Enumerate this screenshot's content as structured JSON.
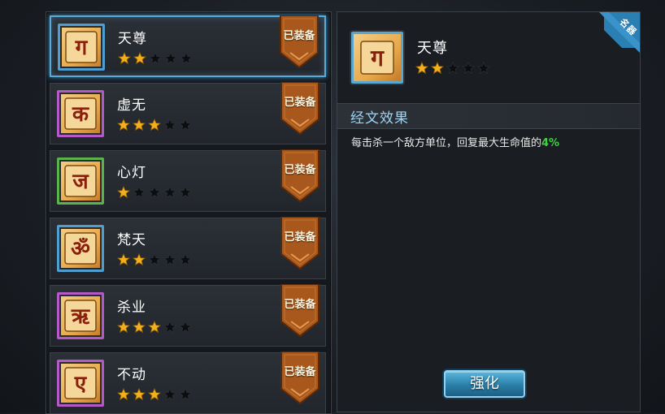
{
  "list": {
    "items": [
      {
        "name": "天尊",
        "stars": 2,
        "max_stars": 5,
        "badge": "已装备",
        "frame": "blue",
        "glyph": "ग",
        "selected": true
      },
      {
        "name": "虚无",
        "stars": 3,
        "max_stars": 5,
        "badge": "已装备",
        "frame": "purple",
        "glyph": "क"
      },
      {
        "name": "心灯",
        "stars": 1,
        "max_stars": 5,
        "badge": "已装备",
        "frame": "green",
        "glyph": "ज"
      },
      {
        "name": "梵天",
        "stars": 2,
        "max_stars": 5,
        "badge": "已装备",
        "frame": "blue",
        "glyph": "ॐ"
      },
      {
        "name": "杀业",
        "stars": 3,
        "max_stars": 5,
        "badge": "已装备",
        "frame": "purple",
        "glyph": "ऋ"
      },
      {
        "name": "不动",
        "stars": 3,
        "max_stars": 5,
        "badge": "已装备",
        "frame": "purple",
        "glyph": "ए"
      }
    ]
  },
  "detail": {
    "corner_tag": "名器",
    "name": "天尊",
    "glyph": "ग",
    "stars": 2,
    "max_stars": 5,
    "section_title": "经文效果",
    "effect_text": "每击杀一个敌方单位，回复最大生命值的",
    "effect_value": "4%",
    "upgrade_label": "强化"
  },
  "colors": {
    "star_filled": "#f2b01e",
    "star_empty": "#0c0d0f",
    "badge": "#a8581c",
    "accent": "#5aa9d6"
  }
}
